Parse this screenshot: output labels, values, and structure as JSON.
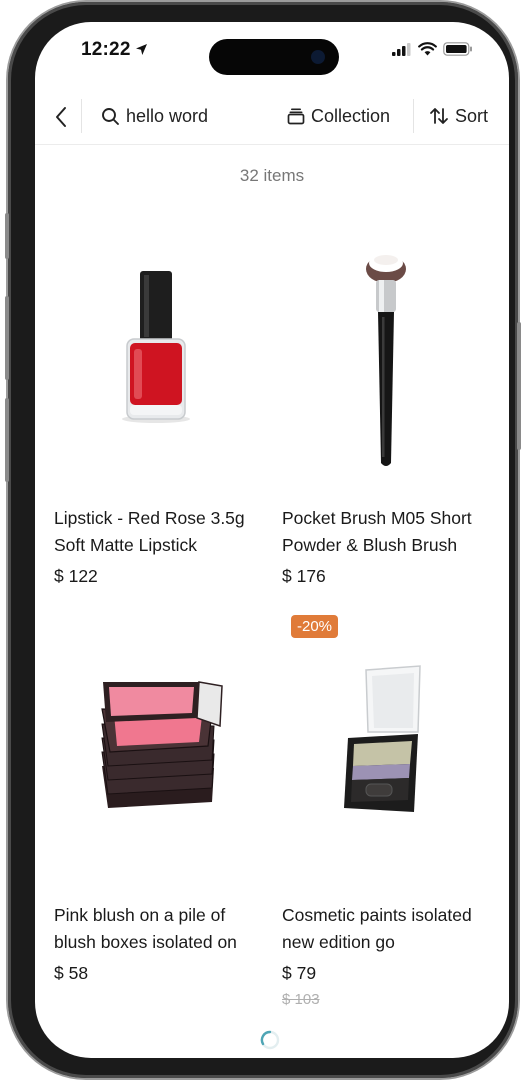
{
  "status_bar": {
    "time": "12:22"
  },
  "nav": {
    "search_text": "hello word",
    "collection_label": "Collection",
    "sort_label": "Sort"
  },
  "results": {
    "count_label": "32 items"
  },
  "products": [
    {
      "title": "Lipstick - Red Rose 3.5g Soft Matte Lipstick",
      "price": "$ 122"
    },
    {
      "title": "Pocket Brush M05 Short Powder & Blush Brush",
      "price": "$ 176"
    },
    {
      "title": "Pink blush on a pile of blush boxes isolated on",
      "price": "$ 58"
    },
    {
      "title": "Cosmetic paints isolated new edition go",
      "price": "$ 79",
      "old_price": "$ 103",
      "badge": "-20%"
    }
  ],
  "colors": {
    "badge": "#e07b39",
    "loader": "#4fa5b5"
  }
}
